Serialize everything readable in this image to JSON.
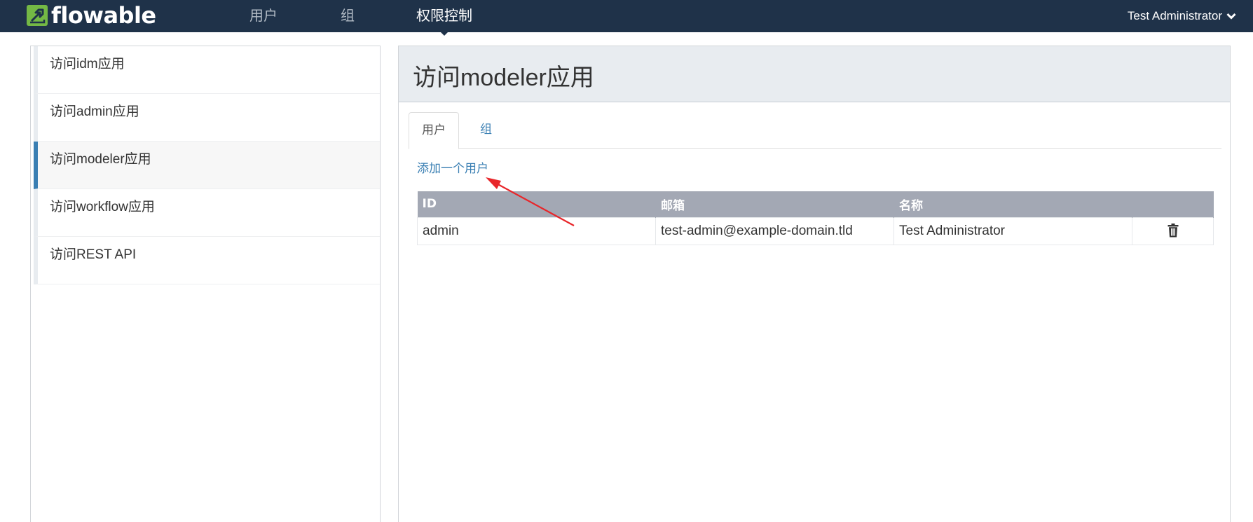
{
  "brand": {
    "name": "Flowable",
    "text": "flowable"
  },
  "nav": {
    "items": [
      {
        "label": "用户",
        "active": false
      },
      {
        "label": "组",
        "active": false
      },
      {
        "label": "权限控制",
        "active": true
      }
    ],
    "user_name": "Test Administrator"
  },
  "sidebar": {
    "items": [
      {
        "label": "访问idm应用",
        "active": false
      },
      {
        "label": "访问admin应用",
        "active": false
      },
      {
        "label": "访问modeler应用",
        "active": true
      },
      {
        "label": "访问workflow应用",
        "active": false
      },
      {
        "label": "访问REST API",
        "active": false
      }
    ]
  },
  "main": {
    "title": "访问modeler应用",
    "tabs": [
      {
        "label": "用户",
        "active": true
      },
      {
        "label": "组",
        "active": false
      }
    ],
    "add_user_label": "添加一个用户",
    "table": {
      "headers": [
        "ID",
        "邮箱",
        "名称",
        ""
      ],
      "rows": [
        {
          "id": "admin",
          "email": "test-admin@example-domain.tld",
          "name": "Test Administrator"
        }
      ]
    }
  },
  "icons": {
    "logo": "flowable-logo-icon",
    "user_menu": "chevron-down-icon",
    "row_action": "trash-icon"
  },
  "colors": {
    "navbar": "#1f3249",
    "accent": "#3a7fb3",
    "logo_green": "#74b845",
    "table_header": "#a3a8b4",
    "annotation_arrow": "#e8262a"
  }
}
